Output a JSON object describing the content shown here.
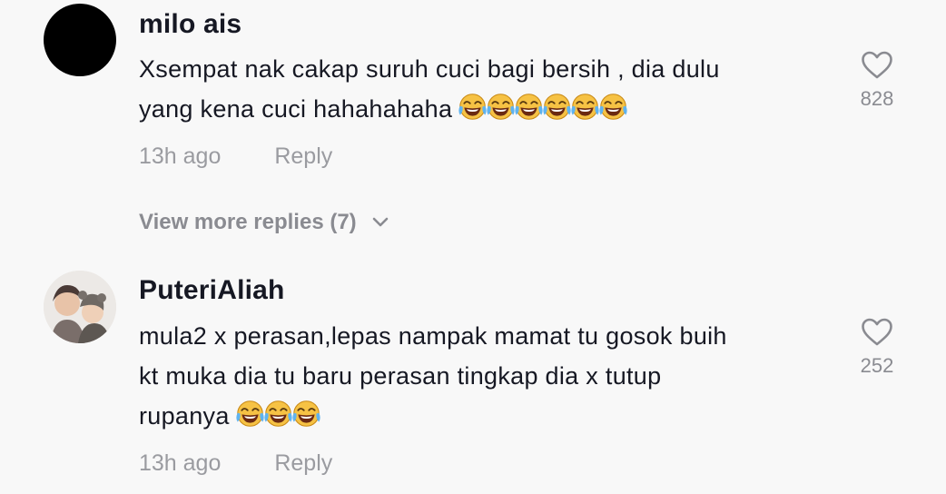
{
  "comments": [
    {
      "username": "milo ais",
      "lines": [
        "Xsempat nak cakap suruh cuci bagi bersih , dia dulu",
        "yang kena cuci hahahahaha"
      ],
      "emoji": "face-with-tears-of-joy",
      "emoji_count": 6,
      "time": "13h ago",
      "reply_label": "Reply",
      "like_count": "828",
      "view_more": "View more replies (7)"
    },
    {
      "username": "PuteriAliah",
      "lines": [
        "mula2 x perasan,lepas nampak mamat tu gosok buih",
        "kt muka dia tu baru perasan tingkap dia x tutup",
        "rupanya"
      ],
      "emoji": "face-with-tears-of-joy",
      "emoji_count": 3,
      "time": "13h ago",
      "reply_label": "Reply",
      "like_count": "252"
    }
  ],
  "colors": {
    "background": "#f8f8f8",
    "text": "#161823",
    "muted": "#9a9ba0"
  }
}
